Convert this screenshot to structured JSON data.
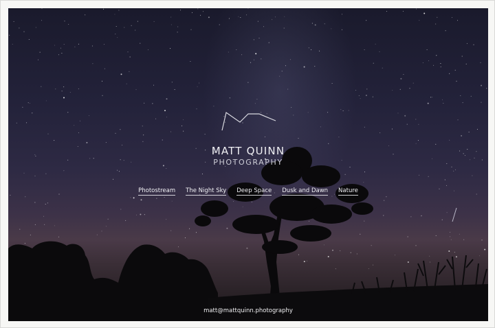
{
  "site": {
    "title": "MATT QUINN",
    "subtitle": "PHOTOGRAPHY",
    "email": "matt@mattquinn.photography"
  },
  "nav": {
    "items": [
      {
        "label": "Photostream"
      },
      {
        "label": "The Night Sky"
      },
      {
        "label": "Deep Space"
      },
      {
        "label": "Dusk and Dawn"
      },
      {
        "label": "Nature"
      }
    ]
  },
  "colors": {
    "sky_top": "#1a1a2c",
    "horizon_glow": "#4a3a48",
    "text": "#f0f0f4"
  },
  "icons": {
    "logo": "mountain-peaks-logo-icon"
  }
}
